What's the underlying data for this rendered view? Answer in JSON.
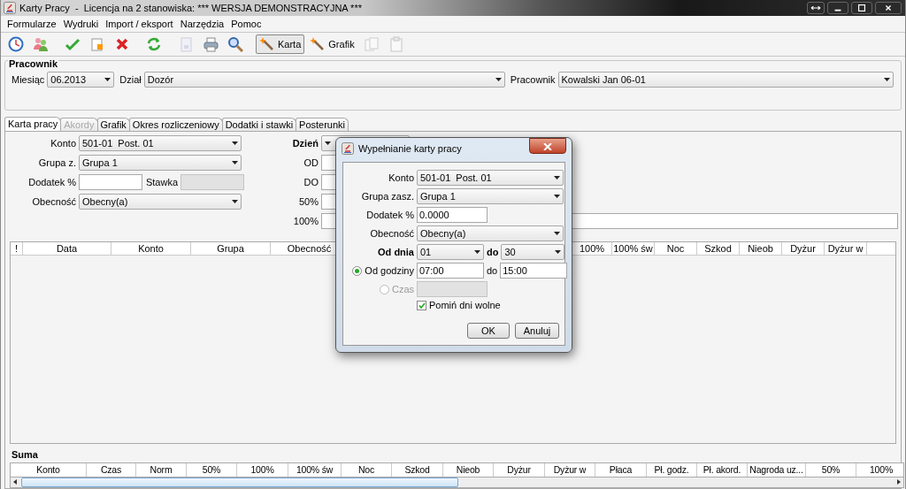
{
  "window": {
    "title": "Karty Pracy  -  Licencja na 2 stanowiska: *** WERSJA DEMONSTRACYJNA ***"
  },
  "menu": [
    "Formularze",
    "Wydruki",
    "Import / eksport",
    "Narzędzia",
    "Pomoc"
  ],
  "toolbar": [
    {
      "kind": "clock",
      "disabled": false,
      "selected": false
    },
    {
      "kind": "people",
      "disabled": false,
      "selected": false
    },
    {
      "kind": "check",
      "disabled": false,
      "selected": false
    },
    {
      "kind": "new",
      "disabled": false,
      "selected": false
    },
    {
      "kind": "delete",
      "disabled": false,
      "selected": false
    },
    {
      "kind": "refresh",
      "disabled": false,
      "selected": false
    },
    {
      "kind": "doc",
      "disabled": true,
      "selected": false
    },
    {
      "kind": "print",
      "disabled": false,
      "selected": false
    },
    {
      "kind": "search",
      "disabled": false,
      "selected": false
    },
    {
      "kind": "wand",
      "label": "Karta",
      "disabled": false,
      "selected": true
    },
    {
      "kind": "wand",
      "label": "Grafik",
      "disabled": false,
      "selected": false
    },
    {
      "kind": "copy",
      "disabled": true,
      "selected": false
    },
    {
      "kind": "paste",
      "disabled": true,
      "selected": false
    }
  ],
  "employee": {
    "title": "Pracownik",
    "fields": [
      {
        "label": "Miesiąc",
        "value": "06.2013"
      },
      {
        "label": "Dział",
        "value": "Dozór"
      },
      {
        "label": "Pracownik",
        "value": "Kowalski Jan 06-01"
      }
    ]
  },
  "tabs": [
    {
      "label": "Karta pracy",
      "selected": true,
      "disabled": false
    },
    {
      "label": "Akordy",
      "selected": false,
      "disabled": true
    },
    {
      "label": "Grafik",
      "selected": false,
      "disabled": false
    },
    {
      "label": "Okres rozliczeniowy",
      "selected": false,
      "disabled": false
    },
    {
      "label": "Dodatki i stawki",
      "selected": false,
      "disabled": false
    },
    {
      "label": "Posterunki",
      "selected": false,
      "disabled": false
    }
  ],
  "form": {
    "left_rows": [
      [
        {
          "label": "Konto",
          "kind": "combo",
          "value": "501-01  Post. 01",
          "disabled": false
        }
      ],
      [
        {
          "label": "Grupa z.",
          "kind": "combo",
          "value": "Grupa 1",
          "disabled": false
        }
      ],
      [
        {
          "label": "Dodatek %",
          "kind": "text",
          "disabled": false
        },
        {
          "label": "Stawka",
          "kind": "text",
          "disabled": true
        }
      ],
      [
        {
          "label": "Obecność",
          "kind": "combo",
          "value": "Obecny(a)",
          "disabled": false
        }
      ]
    ],
    "mid_rows": [
      {
        "label": "Dzień",
        "kind": "combo",
        "bold": true
      },
      {
        "label": "OD",
        "kind": "text",
        "bold": false
      },
      {
        "label": "DO",
        "kind": "text",
        "bold": false
      },
      {
        "label": "50%",
        "kind": "text",
        "bold": false
      },
      {
        "label": "100%",
        "kind": "wide",
        "bold": false
      }
    ]
  },
  "table": {
    "columns": [
      "!",
      "Data",
      "Konto",
      "Grupa",
      "Obecność",
      "100%",
      "100% św",
      "Noc",
      "Szkod",
      "Nieob",
      "Dyżur",
      "Dyżur w"
    ]
  },
  "summary": {
    "title": "Suma",
    "columns": [
      "Konto",
      "Czas",
      "Norm",
      "50%",
      "100%",
      "100% św",
      "Noc",
      "Szkod",
      "Nieob",
      "Dyżur",
      "Dyżur w",
      "Płaca",
      "Pł. godz.",
      "Pł. akord.",
      "Nagroda uz...",
      "50%",
      "100%"
    ]
  },
  "dialog": {
    "title": "Wypełnianie karty pracy",
    "rows": [
      {
        "kind": "combo",
        "label": "Konto",
        "value": "501-01  Post. 01"
      },
      {
        "kind": "combo",
        "label": "Grupa zasz.",
        "value": "Grupa 1"
      },
      {
        "kind": "text",
        "label": "Dodatek %",
        "value": "0.0000"
      },
      {
        "kind": "combo",
        "label": "Obecność",
        "value": "Obecny(a)"
      },
      {
        "kind": "range",
        "label": "Od dnia",
        "from": "01",
        "to_label": "do",
        "to": "30"
      },
      {
        "kind": "radio_range",
        "label": "Od godziny",
        "selected": true,
        "disabled": false,
        "from": "07:00",
        "to_label": "do",
        "to": "15:00"
      },
      {
        "kind": "radio_field",
        "label": "Czas",
        "selected": false,
        "disabled": true
      },
      {
        "kind": "checkbox",
        "label": "Pomiń dni wolne",
        "checked": true
      }
    ],
    "buttons": [
      "OK",
      "Anuluj"
    ]
  }
}
